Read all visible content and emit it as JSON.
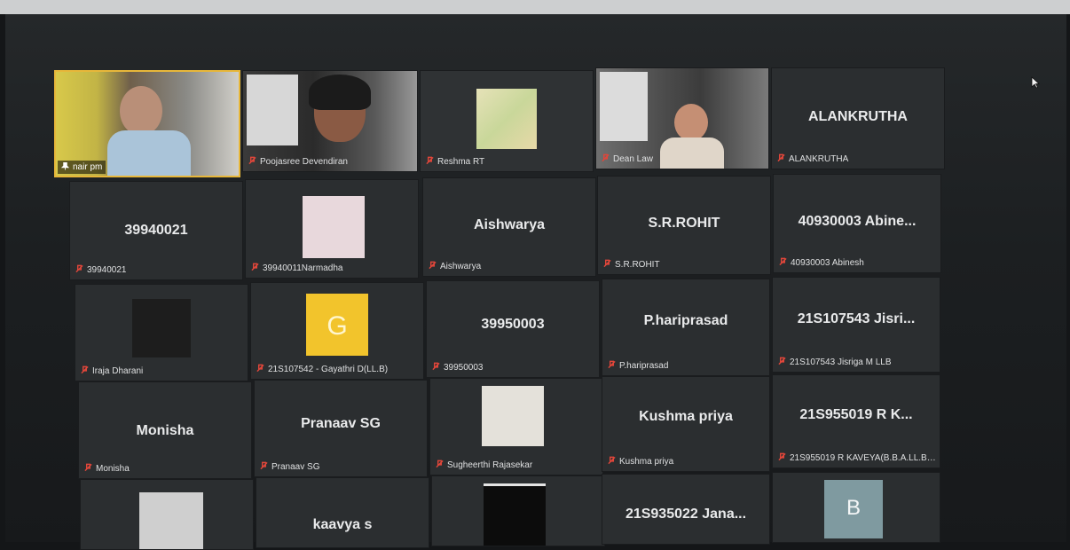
{
  "colors": {
    "background": "#141618",
    "tile": "#2b2e30",
    "active_speaker_border": "#e7b73a",
    "muted_icon": "#e0463a",
    "name_text": "#dfe0e1"
  },
  "icons": {
    "muted": "mic-muted-icon",
    "pinned": "pin-icon",
    "cursor": "mouse-cursor-icon"
  },
  "tiles": [
    {
      "big": "",
      "name": "nair pm",
      "muted": false,
      "pinned": true,
      "video": true,
      "active": true
    },
    {
      "big": "",
      "name": "Poojasree Devendiran",
      "muted": true,
      "video": true
    },
    {
      "big": "",
      "name": "Reshma RT",
      "muted": true,
      "video": false
    },
    {
      "big": "",
      "name": "Dean Law",
      "muted": true,
      "video": true
    },
    {
      "big": "ALANKRUTHA",
      "name": "ALANKRUTHA",
      "muted": true
    },
    {
      "big": "39940021",
      "name": "39940021",
      "muted": true
    },
    {
      "big": "",
      "name": "39940011Narmadha",
      "muted": true
    },
    {
      "big": "Aishwarya",
      "name": "Aishwarya",
      "muted": true
    },
    {
      "big": "S.R.ROHIT",
      "name": "S.R.ROHIT",
      "muted": true
    },
    {
      "big": "40930003  Abine...",
      "name": "40930003 Abinesh",
      "muted": true
    },
    {
      "big": "",
      "name": "Iraja Dharani",
      "muted": true
    },
    {
      "big": "G",
      "name": "21S107542 - Gayathri D(LL.B)",
      "muted": true
    },
    {
      "big": "39950003",
      "name": "39950003",
      "muted": true
    },
    {
      "big": "P.hariprasad",
      "name": "P.hariprasad",
      "muted": true
    },
    {
      "big": "21S107543  Jisri...",
      "name": "21S107543 Jisriga M LLB",
      "muted": true
    },
    {
      "big": "Monisha",
      "name": "Monisha",
      "muted": true
    },
    {
      "big": "Pranaav SG",
      "name": "Pranaav SG",
      "muted": true
    },
    {
      "big": "",
      "name": "Sugheerthi Rajasekar",
      "muted": true
    },
    {
      "big": "Kushma priya",
      "name": "Kushma priya",
      "muted": true
    },
    {
      "big": "21S955019  R  K...",
      "name": "21S955019 R KAVEYA(B.B.A.LL.B)h...",
      "muted": true
    },
    {
      "big": "",
      "name": "",
      "muted": false
    },
    {
      "big": "kaavya s",
      "name": "",
      "muted": false
    },
    {
      "big": "",
      "name": "",
      "muted": false
    },
    {
      "big": "21S935022  Jana...",
      "name": "",
      "muted": false
    },
    {
      "big": "B",
      "name": "",
      "muted": false
    }
  ]
}
